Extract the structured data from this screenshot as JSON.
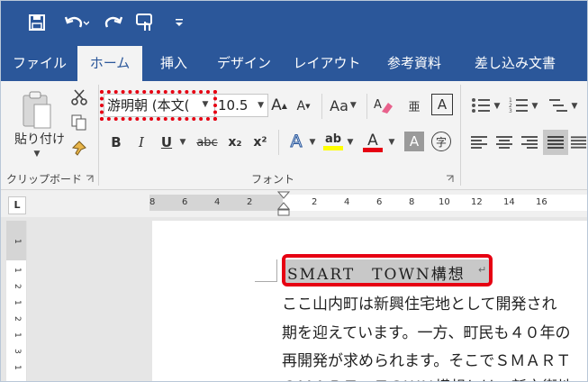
{
  "tabs": [
    "ファイル",
    "ホーム",
    "挿入",
    "デザイン",
    "レイアウト",
    "参考資料",
    "差し込み文書"
  ],
  "active_tab": "ホーム",
  "clipboard": {
    "paste_label": "貼り付け",
    "group_label": "クリップボード"
  },
  "font": {
    "name": "游明朝 (本文(",
    "size": "10.5",
    "group_label": "フォント",
    "grow": "A",
    "shrink": "A",
    "case": "Aa",
    "bold": "B",
    "italic": "I",
    "underline": "U",
    "strike": "abc",
    "sub": "x₂",
    "sup": "x²",
    "effects": "A",
    "highlight": "ab",
    "color": "A",
    "shade": "A",
    "enclose": "字",
    "phonetic": "亜",
    "border_char": "A"
  },
  "ruler": {
    "corner": "L",
    "ticks": [
      "8",
      "6",
      "4",
      "2",
      "2",
      "4",
      "6",
      "8",
      "10",
      "12",
      "14",
      "16"
    ]
  },
  "document": {
    "title": "SMART　TOWN構想",
    "lines": [
      "ここ山内町は新興住宅地として開発され",
      "期を迎えています。一方、町民も４０年の",
      "再開発が求められます。そこでＳＭＡＲＴ",
      "ＳＭＡＲＴ　ＴＯＷＮ構想とは、新市街地"
    ]
  },
  "colors": {
    "accent": "#2b579a",
    "highlight_red": "#e60012",
    "highlight_yellow": "#ffff00"
  }
}
